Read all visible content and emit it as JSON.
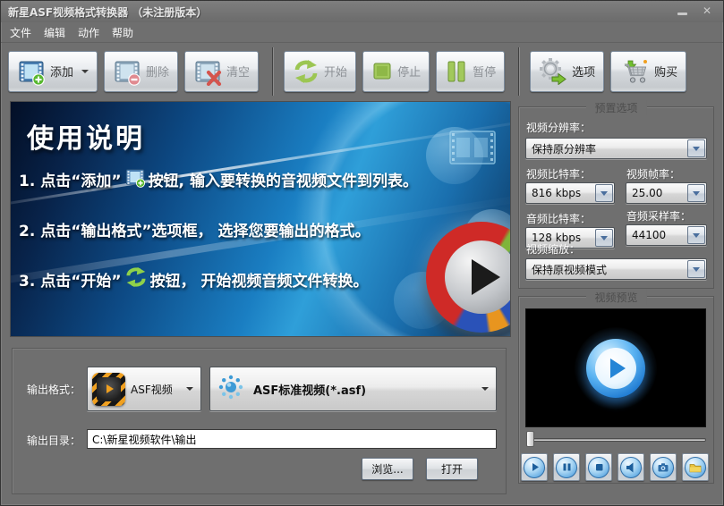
{
  "window": {
    "title": "新星ASF视频格式转换器 （未注册版本）",
    "close_glyph": "✕"
  },
  "menu": {
    "items": [
      "文件",
      "编辑",
      "动作",
      "帮助"
    ]
  },
  "toolbar": {
    "add_label": "添加",
    "delete_label": "删除",
    "clear_label": "清空",
    "start_label": "开始",
    "stop_label": "停止",
    "pause_label": "暂停",
    "options_label": "选项",
    "buy_label": "购买"
  },
  "instructions": {
    "title": "使用说明",
    "step1_pre": "1. 点击“添加”",
    "step1_post": "按钮, 输入要转换的音视频文件到列表。",
    "step2": "2. 点击“输出格式”选项框， 选择您要输出的格式。",
    "step3_pre": "3. 点击“开始”",
    "step3_post": "按钮， 开始视频音频文件转换。"
  },
  "preset": {
    "title": "预置选项",
    "video_resolution_label": "视频分辨率：",
    "video_resolution_value": "保持原分辨率",
    "video_bitrate_label": "视频比特率：",
    "video_bitrate_value": "816 kbps",
    "video_framerate_label": "视频帧率：",
    "video_framerate_value": "25.00",
    "audio_bitrate_label": "音频比特率：",
    "audio_bitrate_value": "128 kbps",
    "audio_samplerate_label": "音频采样率：",
    "audio_samplerate_value": "44100",
    "video_scale_label": "视频缩放：",
    "video_scale_value": "保持原视频模式"
  },
  "preview": {
    "title": "视频预览"
  },
  "output": {
    "format_label": "输出格式：",
    "format_type_value": "ASF视频",
    "format_profile_value": "ASF标准视频(*.asf)",
    "dir_label": "输出目录：",
    "dir_value": "C:\\新星视频软件\\输出",
    "browse_label": "浏览...",
    "open_label": "打开"
  },
  "colors": {
    "window_bg": "#6f6f6f",
    "stage_blue": "#1a7ec2",
    "accent_green": "#8cc63f",
    "logo_red": "#cf2a27",
    "logo_blue": "#2a52b8"
  }
}
